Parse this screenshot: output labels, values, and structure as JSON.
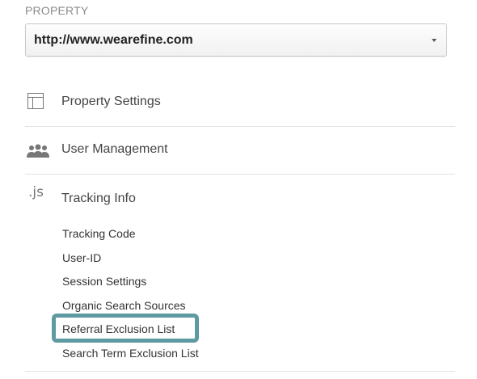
{
  "property": {
    "section_label": "PROPERTY",
    "selected_value": "http://www.wearefine.com",
    "dropdown_icon": "caret-down-icon"
  },
  "nav": {
    "items": [
      {
        "label": "Property Settings",
        "icon": "property-settings-icon"
      },
      {
        "label": "User Management",
        "icon": "users-icon"
      },
      {
        "label": "Tracking Info",
        "icon": "js-icon",
        "icon_text": ".js"
      }
    ],
    "tracking_sub_items": [
      {
        "label": "Tracking Code"
      },
      {
        "label": "User-ID"
      },
      {
        "label": "Session Settings"
      },
      {
        "label": "Organic Search Sources"
      },
      {
        "label": "Referral Exclusion List",
        "highlighted": true
      },
      {
        "label": "Search Term Exclusion List"
      }
    ]
  },
  "colors": {
    "highlight": "#5d9aa2",
    "divider": "#e3e3e3",
    "icon": "#777777"
  }
}
